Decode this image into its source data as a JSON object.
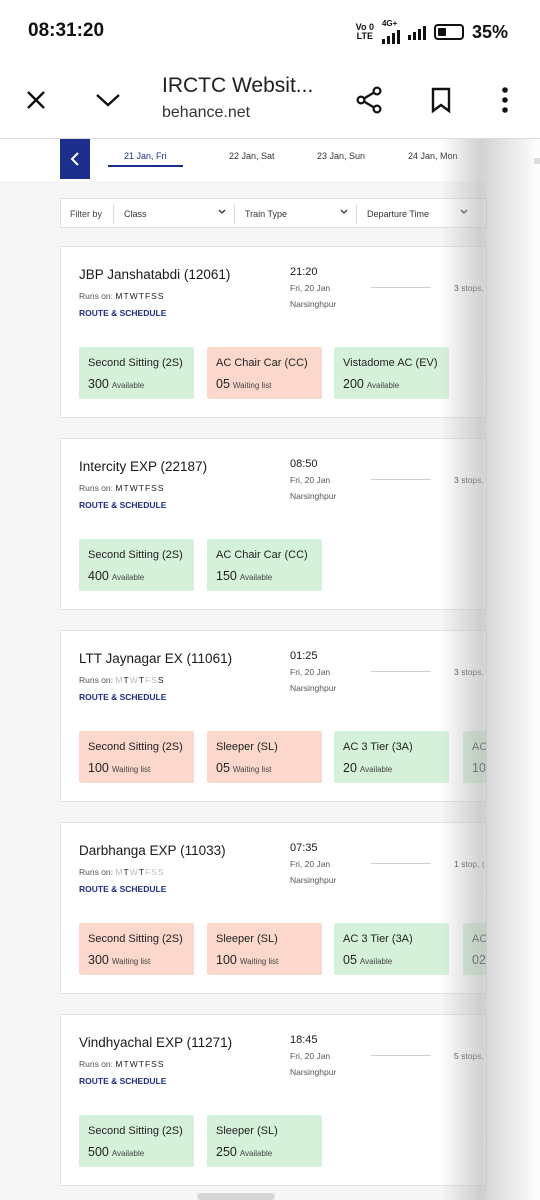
{
  "status_bar": {
    "time": "08:31:20",
    "net_top": "Vo 0",
    "net_bottom": "LTE",
    "net_type": "4G+",
    "battery": "35%",
    "battery_level": 0.35
  },
  "browser": {
    "page_title": "IRCTC Websit...",
    "domain": "behance.net",
    "icons": [
      "close-icon",
      "chevron-down-icon",
      "share-icon",
      "bookmark-icon",
      "more-vert-icon"
    ]
  },
  "dates": [
    {
      "label": "21 Jan, Fri",
      "active": true
    },
    {
      "label": "22 Jan, Sat",
      "active": false
    },
    {
      "label": "23 Jan, Sun",
      "active": false
    },
    {
      "label": "24 Jan, Mon",
      "active": false
    }
  ],
  "filter": {
    "label": "Filter by",
    "class": "Class",
    "train_type": "Train Type",
    "departure_time": "Departure Time"
  },
  "colors": {
    "brand": "#1d2f8d",
    "available_bg": "#d6f1da",
    "waiting_bg": "#fcd8cc"
  },
  "runs_on_label": "Runs on:",
  "route_label": "ROUTE & SCHEDULE",
  "trains": [
    {
      "name": "JBP Janshatabdi (12061)",
      "days": [
        "M",
        "T",
        "W",
        "T",
        "F",
        "S",
        "S"
      ],
      "days_active": [
        true,
        true,
        true,
        true,
        true,
        true,
        true
      ],
      "time": "21:20",
      "date": "Fri, 20 Jan",
      "station": "Narsinghpur",
      "stops": "3 stops,",
      "classes": [
        {
          "name": "Second Sitting (2S)",
          "count": "300",
          "status": "Available",
          "state": "available"
        },
        {
          "name": "AC Chair Car (CC)",
          "count": "05",
          "status": "Waiting list",
          "state": "waiting"
        },
        {
          "name": "Vistadome AC (EV)",
          "count": "200",
          "status": "Available",
          "state": "available"
        }
      ]
    },
    {
      "name": "Intercity EXP (22187)",
      "days": [
        "M",
        "T",
        "W",
        "T",
        "F",
        "S",
        "S"
      ],
      "days_active": [
        true,
        true,
        true,
        true,
        true,
        true,
        true
      ],
      "time": "08:50",
      "date": "Fri, 20 Jan",
      "station": "Narsinghpur",
      "stops": "3 stops,",
      "classes": [
        {
          "name": "Second Sitting (2S)",
          "count": "400",
          "status": "Available",
          "state": "available"
        },
        {
          "name": "AC Chair Car (CC)",
          "count": "150",
          "status": "Available",
          "state": "available"
        }
      ]
    },
    {
      "name": "LTT Jaynagar EX (11061)",
      "days": [
        "M",
        "T",
        "W",
        "T",
        "F",
        "S",
        "S"
      ],
      "days_active": [
        false,
        true,
        false,
        true,
        false,
        false,
        true
      ],
      "time": "01:25",
      "date": "Fri, 20 Jan",
      "station": "Narsinghpur",
      "stops": "3 stops,",
      "classes": [
        {
          "name": "Second Sitting (2S)",
          "count": "100",
          "status": "Waiting list",
          "state": "waiting"
        },
        {
          "name": "Sleeper (SL)",
          "count": "05",
          "status": "Waiting list",
          "state": "waiting"
        },
        {
          "name": "AC 3 Tier (3A)",
          "count": "20",
          "status": "Available",
          "state": "available"
        },
        {
          "name": "AC",
          "count": "10",
          "status": "",
          "state": "available"
        }
      ]
    },
    {
      "name": "Darbhanga EXP (11033)",
      "days": [
        "M",
        "T",
        "W",
        "T",
        "F",
        "S",
        "S"
      ],
      "days_active": [
        false,
        true,
        false,
        true,
        false,
        false,
        false
      ],
      "time": "07:35",
      "date": "Fri, 20 Jan",
      "station": "Narsinghpur",
      "stops": "1 stop, (",
      "classes": [
        {
          "name": "Second Sitting (2S)",
          "count": "300",
          "status": "Waiting list",
          "state": "waiting"
        },
        {
          "name": "Sleeper (SL)",
          "count": "100",
          "status": "Waiting list",
          "state": "waiting"
        },
        {
          "name": "AC 3 Tier (3A)",
          "count": "05",
          "status": "Available",
          "state": "available"
        },
        {
          "name": "AC",
          "count": "02",
          "status": "",
          "state": "available"
        }
      ]
    },
    {
      "name": "Vindhyachal EXP (11271)",
      "days": [
        "M",
        "T",
        "W",
        "T",
        "F",
        "S",
        "S"
      ],
      "days_active": [
        true,
        true,
        true,
        true,
        true,
        true,
        true
      ],
      "time": "18:45",
      "date": "Fri, 20 Jan",
      "station": "Narsinghpur",
      "stops": "5 stops,",
      "classes": [
        {
          "name": "Second Sitting (2S)",
          "count": "500",
          "status": "Available",
          "state": "available"
        },
        {
          "name": "Sleeper (SL)",
          "count": "250",
          "status": "Available",
          "state": "available"
        }
      ]
    }
  ]
}
